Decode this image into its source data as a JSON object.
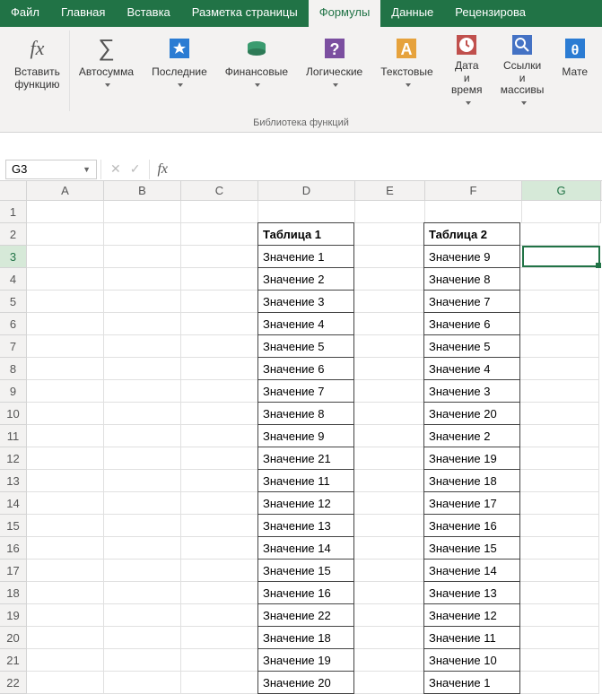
{
  "tabs": [
    "Файл",
    "Главная",
    "Вставка",
    "Разметка страницы",
    "Формулы",
    "Данные",
    "Рецензирова"
  ],
  "active_tab": 4,
  "ribbon": {
    "insert_fn0": "Вставить",
    "insert_fn1": "функцию",
    "autosum": "Автосумма",
    "recent": "Последние",
    "financial": "Финансовые",
    "logical": "Логические",
    "text": "Текстовые",
    "datetime0": "Дата и",
    "datetime1": "время",
    "lookup0": "Ссылки и",
    "lookup1": "массивы",
    "math": "Мате",
    "group_caption": "Библиотека функций"
  },
  "namebox": "G3",
  "formula": "",
  "cols": [
    "A",
    "B",
    "C",
    "D",
    "E",
    "F",
    "G"
  ],
  "active_col": "G",
  "active_row": 3,
  "rowcount": 22,
  "tableD": {
    "header": "Таблица 1",
    "rows": [
      "Значение 1",
      "Значение 2",
      "Значение 3",
      "Значение 4",
      "Значение 5",
      "Значение 6",
      "Значение 7",
      "Значение 8",
      "Значение 9",
      "Значение 21",
      "Значение 11",
      "Значение 12",
      "Значение 13",
      "Значение 14",
      "Значение 15",
      "Значение 16",
      "Значение 22",
      "Значение 18",
      "Значение 19",
      "Значение 20"
    ]
  },
  "tableF": {
    "header": "Таблица 2",
    "rows": [
      "Значение 9",
      "Значение 8",
      "Значение 7",
      "Значение 6",
      "Значение 5",
      "Значение 4",
      "Значение 3",
      "Значение 20",
      "Значение 2",
      "Значение 19",
      "Значение 18",
      "Значение 17",
      "Значение 16",
      "Значение 15",
      "Значение 14",
      "Значение 13",
      "Значение 12",
      "Значение 11",
      "Значение 10",
      "Значение 1"
    ]
  }
}
